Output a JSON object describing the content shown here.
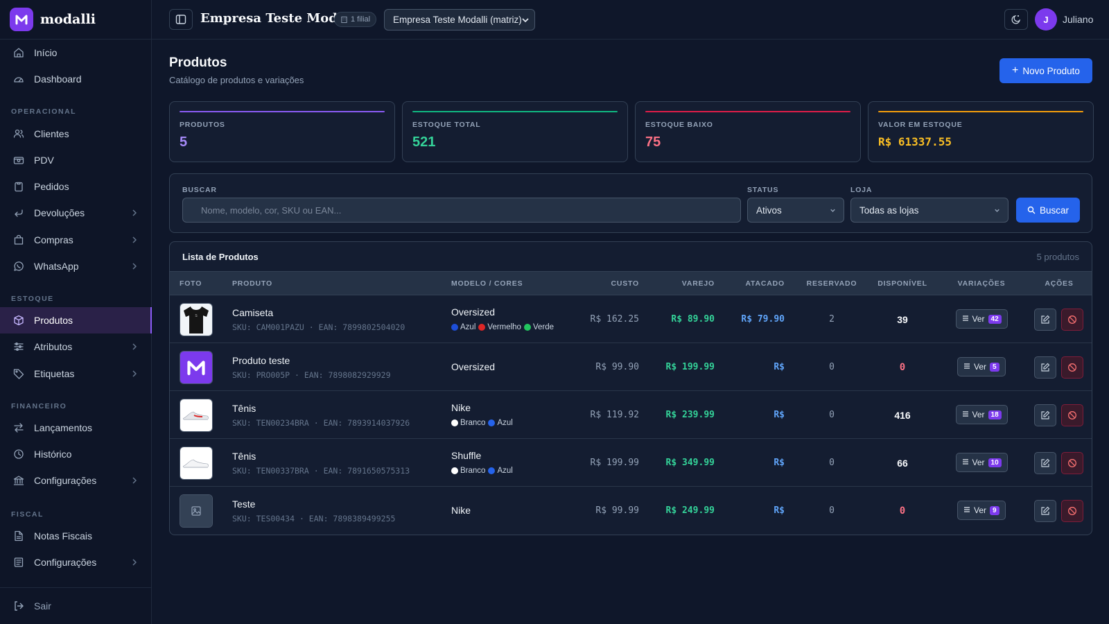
{
  "brand": {
    "name": "modalli",
    "logo_letter": "M",
    "accent": "#7c3aed"
  },
  "sidebar": {
    "top_items": [
      {
        "label": "Início",
        "icon": "home-icon"
      },
      {
        "label": "Dashboard",
        "icon": "gauge-icon"
      }
    ],
    "sections": [
      {
        "title": "OPERACIONAL",
        "items": [
          {
            "label": "Clientes",
            "icon": "users-icon",
            "expandable": false
          },
          {
            "label": "PDV",
            "icon": "register-icon",
            "expandable": false
          },
          {
            "label": "Pedidos",
            "icon": "clipboard-icon",
            "expandable": false
          },
          {
            "label": "Devoluções",
            "icon": "return-icon",
            "expandable": true
          },
          {
            "label": "Compras",
            "icon": "shopping-bag-icon",
            "expandable": true
          },
          {
            "label": "WhatsApp",
            "icon": "whatsapp-icon",
            "expandable": true
          }
        ]
      },
      {
        "title": "ESTOQUE",
        "items": [
          {
            "label": "Produtos",
            "icon": "box-icon",
            "expandable": false,
            "active": true
          },
          {
            "label": "Atributos",
            "icon": "sliders-icon",
            "expandable": true
          },
          {
            "label": "Etiquetas",
            "icon": "tag-icon",
            "expandable": true
          }
        ]
      },
      {
        "title": "FINANCEIRO",
        "items": [
          {
            "label": "Lançamentos",
            "icon": "transfer-icon",
            "expandable": false
          },
          {
            "label": "Histórico",
            "icon": "clock-icon",
            "expandable": false
          },
          {
            "label": "Configurações",
            "icon": "bank-icon",
            "expandable": true
          }
        ]
      },
      {
        "title": "FISCAL",
        "items": [
          {
            "label": "Notas Fiscais",
            "icon": "file-icon",
            "expandable": false
          },
          {
            "label": "Configurações",
            "icon": "receipt-icon",
            "expandable": true
          }
        ]
      }
    ],
    "logout": "Sair"
  },
  "header": {
    "company": "Empresa Teste Modalli",
    "filial_badge": "1 filial",
    "store_select": "Empresa Teste Modalli (matriz)",
    "user_initial": "J",
    "user_name": "Juliano"
  },
  "page": {
    "title": "Produtos",
    "subtitle": "Catálogo de produtos e variações",
    "new_button": "Novo Produto"
  },
  "stats": [
    {
      "label": "PRODUTOS",
      "value": "5",
      "color": "#a78bfa",
      "line": "#8b5cf6"
    },
    {
      "label": "ESTOQUE TOTAL",
      "value": "521",
      "color": "#34d399",
      "line": "#10b981"
    },
    {
      "label": "ESTOQUE BAIXO",
      "value": "75",
      "color": "#fb7185",
      "line": "#e11d48"
    },
    {
      "label": "VALOR EM ESTOQUE",
      "value": "R$ 61337.55",
      "color": "#fbbf24",
      "line": "#f59e0b"
    }
  ],
  "filters": {
    "search_label": "BUSCAR",
    "search_placeholder": "Nome, modelo, cor, SKU ou EAN...",
    "status_label": "STATUS",
    "status_value": "Ativos",
    "store_label": "LOJA",
    "store_value": "Todas as lojas",
    "search_button": "Buscar"
  },
  "table": {
    "title": "Lista de Produtos",
    "count": "5 produtos",
    "columns": [
      "FOTO",
      "PRODUTO",
      "MODELO / CORES",
      "CUSTO",
      "VAREJO",
      "ATACADO",
      "RESERVADO",
      "DISPONÍVEL",
      "VARIAÇÕES",
      "AÇÕES"
    ],
    "ver_label": "Ver",
    "rows": [
      {
        "name": "Camiseta",
        "sku": "SKU: CAM001PAZU",
        "ean": "EAN: 7899802504020",
        "photo": "tshirt",
        "model": "Oversized",
        "colors": [
          {
            "name": "Azul",
            "hex": "#1d4ed8"
          },
          {
            "name": "Vermelho",
            "hex": "#dc2626"
          },
          {
            "name": "Verde",
            "hex": "#22c55e"
          }
        ],
        "cost": "R$ 162.25",
        "retail": "R$ 89.90",
        "wholesale": "R$ 79.90",
        "reserved": "2",
        "available": "39",
        "available_low": false,
        "variations": "42"
      },
      {
        "name": "Produto teste",
        "sku": "SKU: PRO005P",
        "ean": "EAN: 7898082929929",
        "photo": "logo",
        "model": "Oversized",
        "colors": [],
        "cost": "R$ 99.90",
        "retail": "R$ 199.99",
        "wholesale": "R$",
        "reserved": "0",
        "available": "0",
        "available_low": true,
        "variations": "5"
      },
      {
        "name": "Tênis",
        "sku": "SKU: TEN00234BRA",
        "ean": "EAN: 7893914037926",
        "photo": "shoe-red",
        "model": "Nike",
        "colors": [
          {
            "name": "Branco",
            "hex": "#ffffff"
          },
          {
            "name": "Azul",
            "hex": "#2563eb"
          }
        ],
        "cost": "R$ 119.92",
        "retail": "R$ 239.99",
        "wholesale": "R$",
        "reserved": "0",
        "available": "416",
        "available_low": false,
        "variations": "18"
      },
      {
        "name": "Tênis",
        "sku": "SKU: TEN00337BRA",
        "ean": "EAN: 7891650575313",
        "photo": "shoe-white",
        "model": "Shuffle",
        "colors": [
          {
            "name": "Branco",
            "hex": "#ffffff"
          },
          {
            "name": "Azul",
            "hex": "#2563eb"
          }
        ],
        "cost": "R$ 199.99",
        "retail": "R$ 349.99",
        "wholesale": "R$",
        "reserved": "0",
        "available": "66",
        "available_low": false,
        "variations": "10"
      },
      {
        "name": "Teste",
        "sku": "SKU: TES00434",
        "ean": "EAN: 7898389499255",
        "photo": "placeholder",
        "model": "Nike",
        "colors": [],
        "cost": "R$ 99.99",
        "retail": "R$ 249.99",
        "wholesale": "R$",
        "reserved": "0",
        "available": "0",
        "available_low": true,
        "variations": "9"
      }
    ]
  }
}
